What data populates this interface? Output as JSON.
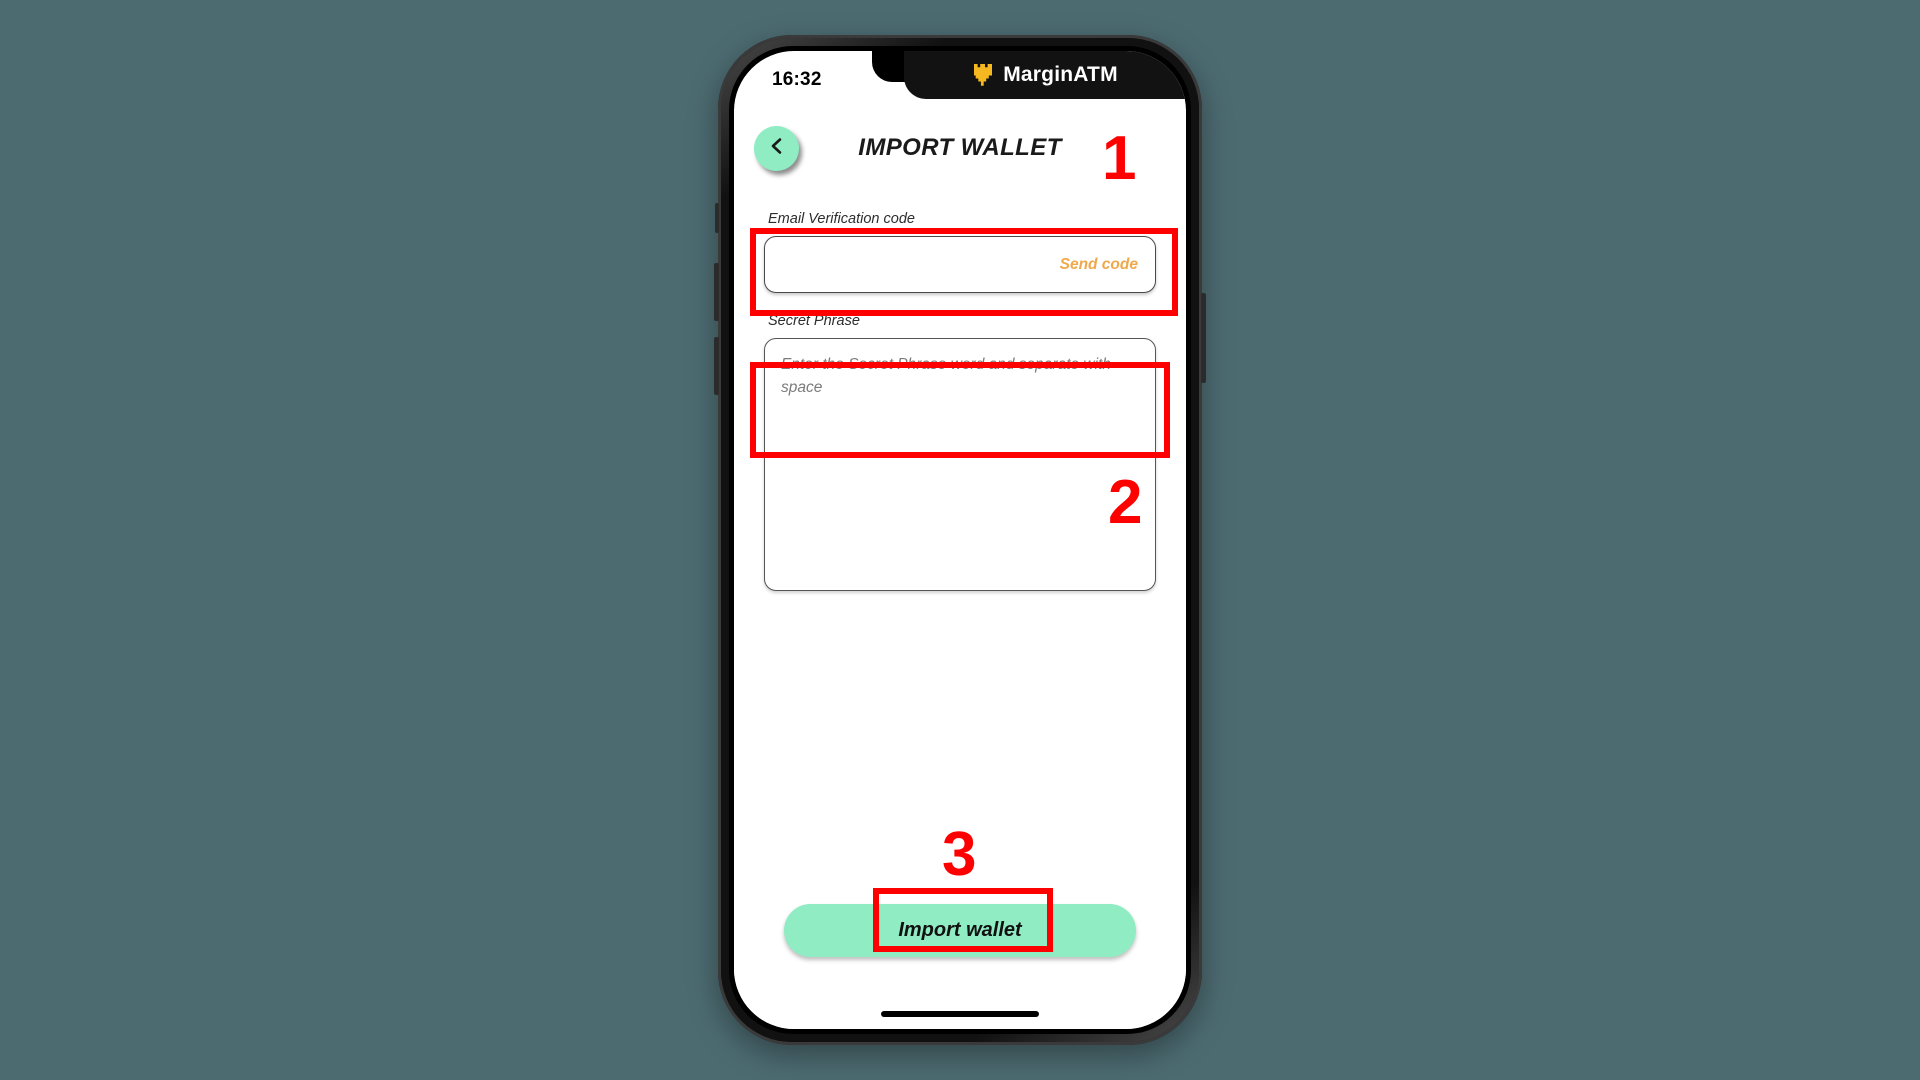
{
  "background_color": "#4c6b71",
  "device": {
    "status_bar": {
      "time": "16:32",
      "signal_icon": "cellular-signal-icon",
      "wifi_icon": "wifi-icon",
      "battery_icon": "battery-icon"
    },
    "brand_banner": {
      "logo_icon": "marginatm-crown-icon",
      "name": "MarginATM",
      "logo_color": "#f5b820",
      "background_color": "#121212"
    }
  },
  "app": {
    "header": {
      "back_icon": "chevron-left-icon",
      "back_button_color": "#8fecc3",
      "title": "IMPORT WALLET"
    },
    "form": {
      "email_code": {
        "label": "Email Verification code",
        "value": "",
        "placeholder": "",
        "send_code_label": "Send code",
        "send_code_color": "#f0a84a"
      },
      "secret_phrase": {
        "label": "Secret Phrase",
        "value": "",
        "placeholder": "Enter the Secret Phrase word and separate with space"
      }
    },
    "primary_action": {
      "label": "Import wallet",
      "color": "#8fecc3"
    }
  },
  "annotations": {
    "color": "#fe0000",
    "steps": [
      {
        "number": "1",
        "target": "email-verification-code-field"
      },
      {
        "number": "2",
        "target": "secret-phrase-input"
      },
      {
        "number": "3",
        "target": "import-wallet-button"
      }
    ]
  }
}
